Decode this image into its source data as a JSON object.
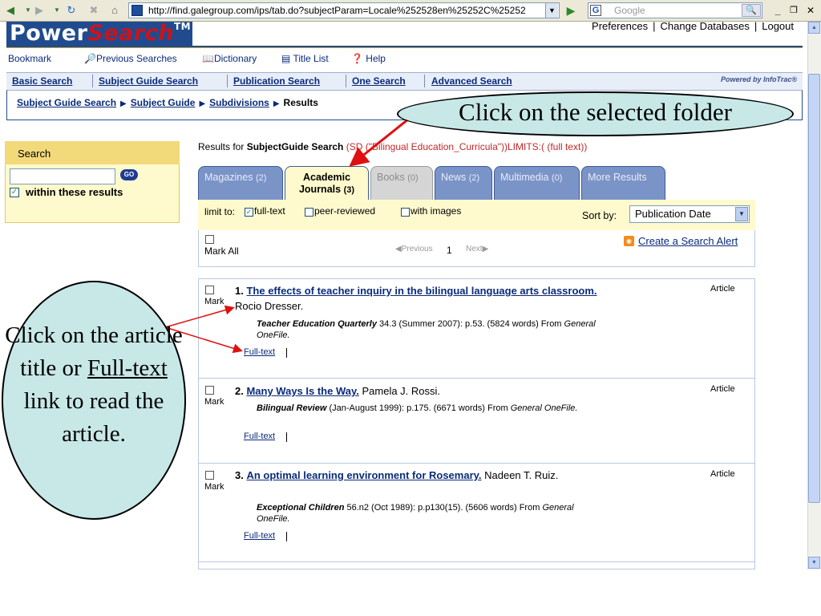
{
  "browser": {
    "url": "http://find.galegroup.com/ips/tab.do?subjectParam=Locale%252528en%25252C%25252",
    "search_placeholder": "Google"
  },
  "header": {
    "logo_part1": "Power",
    "logo_part2": "Search",
    "logo_tm": "TM",
    "links": [
      "Preferences",
      "Change Databases",
      "Logout"
    ]
  },
  "toolbar": {
    "items": [
      "Bookmark",
      "Previous Searches",
      "Dictionary",
      "Title List",
      "Help"
    ]
  },
  "search_tabs": {
    "items": [
      "Basic Search",
      "Subject Guide Search",
      "Publication Search",
      "One Search",
      "Advanced Search"
    ],
    "powered_by": "Powered by InfoTrac®"
  },
  "breadcrumb": {
    "items": [
      "Subject Guide Search",
      "Subject Guide",
      "Subdivisions"
    ],
    "current": "Results"
  },
  "sidebar": {
    "title": "Search",
    "go_label": "GO",
    "within_label": "within these results"
  },
  "results_header": {
    "prefix": "Results for ",
    "search_type": "SubjectGuide Search",
    "query": " (SD (\"Bilingual Education_Curricula\"))LIMITS:( (full text))"
  },
  "result_tabs": [
    {
      "label": "Magazines",
      "count": "(2)",
      "state": "normal"
    },
    {
      "label": "Academic",
      "label2": "Journals",
      "count": "(3)",
      "state": "active"
    },
    {
      "label": "Books",
      "count": "(0)",
      "state": "disabled"
    },
    {
      "label": "News",
      "count": "(2)",
      "state": "normal"
    },
    {
      "label": "Multimedia",
      "count": "(0)",
      "state": "normal"
    },
    {
      "label": "More Results",
      "count": "",
      "state": "normal"
    }
  ],
  "limits": {
    "label": "limit to:",
    "options": [
      {
        "label": "full-text",
        "checked": true
      },
      {
        "label": "peer-reviewed",
        "checked": false
      },
      {
        "label": "with images",
        "checked": false
      }
    ],
    "sort_label": "Sort by:",
    "sort_value": "Publication Date"
  },
  "controls": {
    "mark_all": "Mark All",
    "previous": "Previous",
    "page": "1",
    "next": "Next",
    "alert_link": "Create a Search Alert"
  },
  "results": [
    {
      "number": "1.",
      "title": "The effects of teacher inquiry in the bilingual language arts classroom.",
      "author": " Rocio Dresser.",
      "journal": "Teacher Education Quarterly",
      "citation": " 34.3 (Summer 2007): p.53. (5824 words) From ",
      "database": "General OneFile.",
      "fulltext": "Full-text",
      "type": "Article",
      "mark": "Mark"
    },
    {
      "number": "2.",
      "title": "Many Ways Is the Way.",
      "author": " Pamela J. Rossi.",
      "journal": "Bilingual Review",
      "citation": " (Jan-August 1999): p.175. (6671 words) From ",
      "database": "General OneFile.",
      "fulltext": "Full-text",
      "type": "Article",
      "mark": "Mark"
    },
    {
      "number": "3.",
      "title": "An optimal learning environment for Rosemary.",
      "author": " Nadeen T. Ruiz.",
      "journal": "Exceptional Children",
      "citation": " 56.n2 (Oct 1989): p.p130(15). (5606 words) From ",
      "database": "General OneFile.",
      "fulltext": "Full-text",
      "type": "Article",
      "mark": "Mark"
    }
  ],
  "annotations": {
    "top": "Click on the selected folder",
    "left_1": "Click on the article title or ",
    "left_link": "Full-text",
    "left_2": " link to read the article."
  },
  "colors": {
    "brand_blue": "#204b8f",
    "brand_red": "#c9141c",
    "link_blue": "#0a2a7a",
    "callout_fill": "#c8e8e8",
    "arrow_red": "#e01010"
  }
}
